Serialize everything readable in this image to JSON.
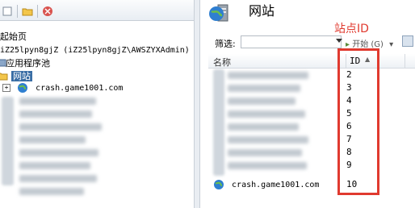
{
  "left": {
    "server_start": "起始页",
    "server_node": "iZ25lpyn8gjZ (iZ25lpyn8gjZ\\AWSZYXAdmin)",
    "app_pools": "应用程序池",
    "sites": "网站",
    "first_site": "crash.game1001.com"
  },
  "right": {
    "title": "网站",
    "filter_label": "筛选:",
    "start_label": "开始 (G)",
    "col_name": "名称",
    "col_id": "ID",
    "ids": [
      "2",
      "3",
      "4",
      "5",
      "6",
      "7",
      "8",
      "9",
      "10"
    ],
    "last_site": "crash.game1001.com",
    "annotation": "站点ID",
    "annotation_color": "#e03a2f"
  }
}
